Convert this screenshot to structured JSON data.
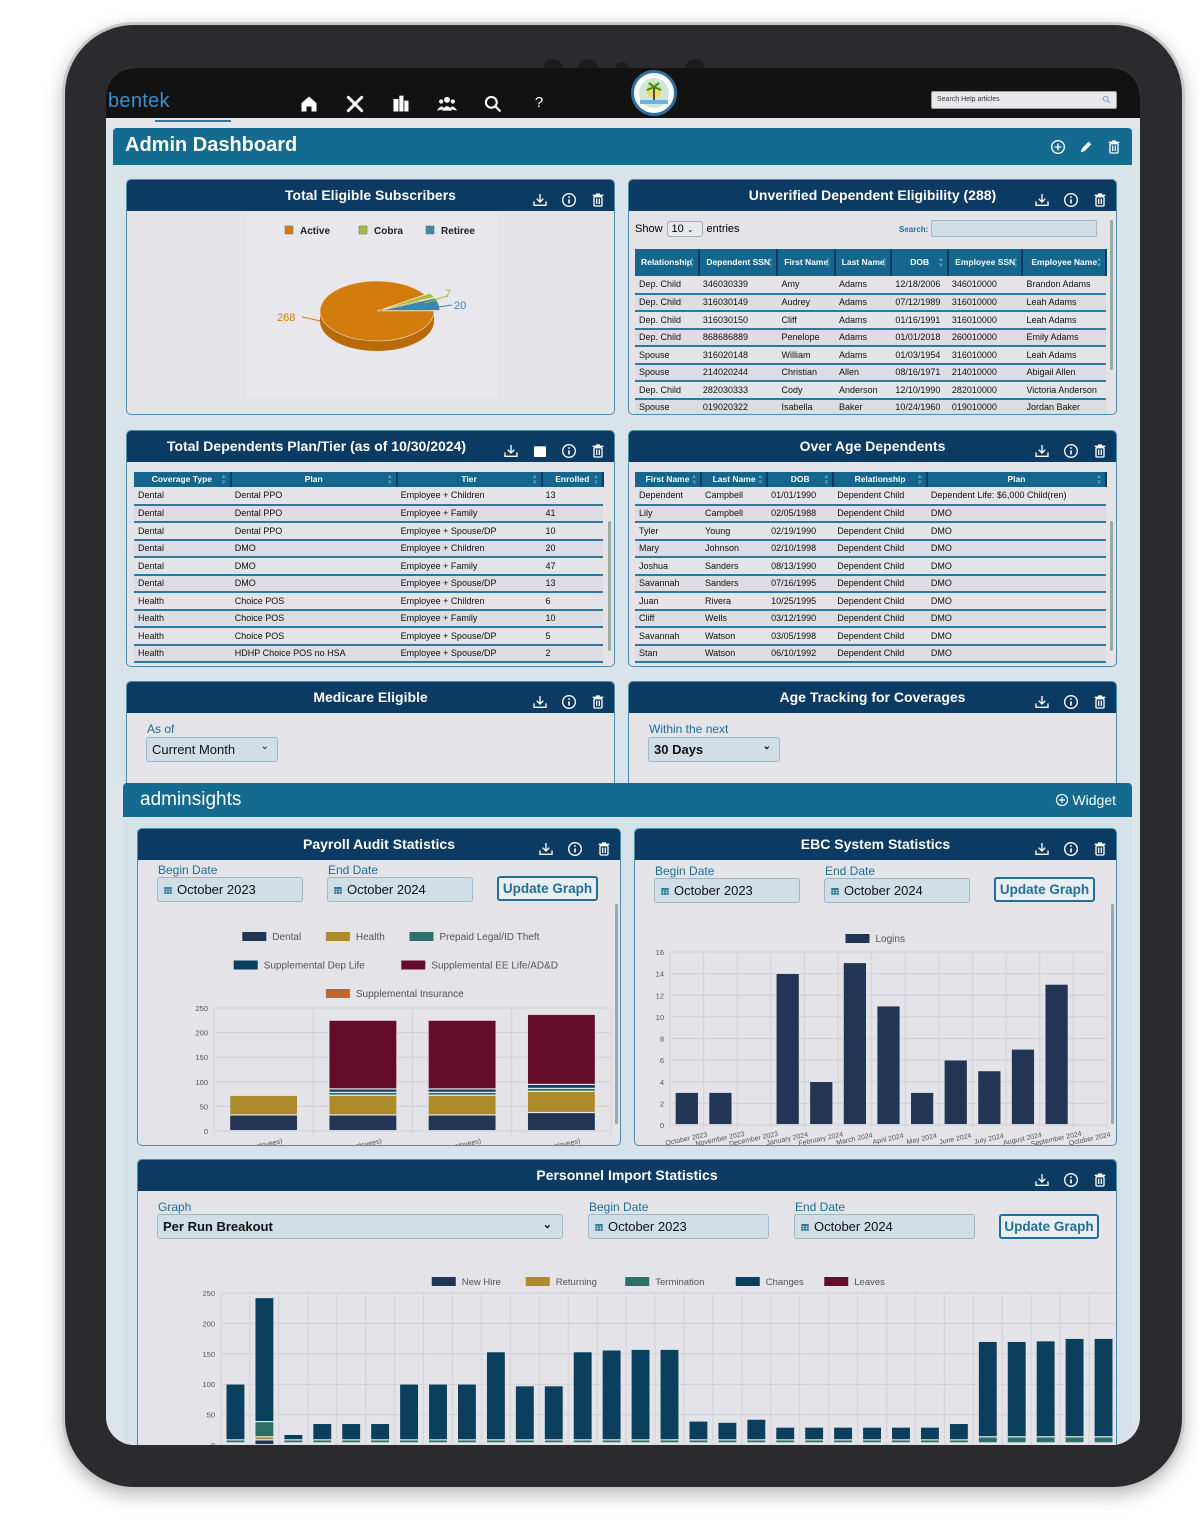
{
  "nav": {
    "logo": "bentek",
    "icons": [
      "home-icon",
      "tools-icon",
      "building-icon",
      "users-icon",
      "search-icon",
      "help-icon"
    ],
    "help_glyph": "?",
    "search_placeholder": "Search Help articles"
  },
  "dashboard": {
    "title": "Admin Dashboard"
  },
  "subscribers": {
    "title": "Total Eligible Subscribers",
    "chart_data": {
      "type": "pie",
      "categories": [
        "Active",
        "Cobra",
        "Retiree"
      ],
      "values": [
        268,
        7,
        20
      ],
      "colors": [
        "#d17c0c",
        "#a9b83f",
        "#3d87aa"
      ],
      "legend": "top"
    }
  },
  "unverified": {
    "title": "Unverified Dependent Eligibility (288)",
    "show": "Show",
    "entries_value": "10",
    "entries": "entries",
    "search_label": "Search:",
    "columns": [
      "Relationship",
      "Dependent SSN",
      "First Name",
      "Last Name",
      "DOB",
      "Employee SSN",
      "Employee Name"
    ],
    "rows": [
      [
        "Dep. Child",
        "346030339",
        "Amy",
        "Adams",
        "12/18/2006",
        "346010000",
        "Brandon Adams"
      ],
      [
        "Dep. Child",
        "316030149",
        "Audrey",
        "Adams",
        "07/12/1989",
        "316010000",
        "Leah Adams"
      ],
      [
        "Dep. Child",
        "316030150",
        "Cliff",
        "Adams",
        "01/16/1991",
        "316010000",
        "Leah Adams"
      ],
      [
        "Dep. Child",
        "868686889",
        "Penelope",
        "Adams",
        "01/01/2018",
        "260010000",
        "Emily Adams"
      ],
      [
        "Spouse",
        "316020148",
        "William",
        "Adams",
        "01/03/1954",
        "316010000",
        "Leah Adams"
      ],
      [
        "Spouse",
        "214020244",
        "Christian",
        "Allen",
        "08/16/1971",
        "214010000",
        "Abigail Allen"
      ],
      [
        "Dep. Child",
        "282030333",
        "Cody",
        "Anderson",
        "12/10/1990",
        "282010000",
        "Victoria Anderson"
      ],
      [
        "Spouse",
        "019020322",
        "Isabella",
        "Baker",
        "10/24/1960",
        "019010000",
        "Jordan Baker"
      ]
    ]
  },
  "plantier": {
    "title": "Total Dependents Plan/Tier (as of 10/30/2024)",
    "columns": [
      "Coverage Type",
      "Plan",
      "Tier",
      "Enrolled"
    ],
    "rows": [
      [
        "Dental",
        "Dental PPO",
        "Employee + Children",
        "13"
      ],
      [
        "Dental",
        "Dental PPO",
        "Employee + Family",
        "41"
      ],
      [
        "Dental",
        "Dental PPO",
        "Employee + Spouse/DP",
        "10"
      ],
      [
        "Dental",
        "DMO",
        "Employee + Children",
        "20"
      ],
      [
        "Dental",
        "DMO",
        "Employee + Family",
        "47"
      ],
      [
        "Dental",
        "DMO",
        "Employee + Spouse/DP",
        "13"
      ],
      [
        "Health",
        "Choice POS",
        "Employee + Children",
        "6"
      ],
      [
        "Health",
        "Choice POS",
        "Employee + Family",
        "10"
      ],
      [
        "Health",
        "Choice POS",
        "Employee + Spouse/DP",
        "5"
      ],
      [
        "Health",
        "HDHP Choice POS no HSA",
        "Employee + Spouse/DP",
        "2"
      ]
    ]
  },
  "overage": {
    "title": "Over Age Dependents",
    "columns": [
      "First Name",
      "Last Name",
      "DOB",
      "Relationship",
      "Plan"
    ],
    "rows": [
      [
        "Dependent",
        "Campbell",
        "01/01/1990",
        "Dependent Child",
        "Dependent Life: $6,000 Child(ren)"
      ],
      [
        "Lily",
        "Campbell",
        "02/05/1988",
        "Dependent Child",
        "DMO"
      ],
      [
        "Tyler",
        "Young",
        "02/19/1990",
        "Dependent Child",
        "DMO"
      ],
      [
        "Mary",
        "Johnson",
        "02/10/1998",
        "Dependent Child",
        "DMO"
      ],
      [
        "Joshua",
        "Sanders",
        "08/13/1990",
        "Dependent Child",
        "DMO"
      ],
      [
        "Savannah",
        "Sanders",
        "07/16/1995",
        "Dependent Child",
        "DMO"
      ],
      [
        "Juan",
        "Rivera",
        "10/25/1995",
        "Dependent Child",
        "DMO"
      ],
      [
        "Cliff",
        "Wells",
        "03/12/1990",
        "Dependent Child",
        "DMO"
      ],
      [
        "Savannah",
        "Watson",
        "03/05/1998",
        "Dependent Child",
        "DMO"
      ],
      [
        "Stan",
        "Watson",
        "06/10/1992",
        "Dependent Child",
        "DMO"
      ]
    ]
  },
  "medicare": {
    "title": "Medicare Eligible",
    "label": "As of",
    "value": "Current Month"
  },
  "agetracking": {
    "title": "Age Tracking for Coverages",
    "label": "Within the next",
    "value": "30 Days"
  },
  "insights": {
    "logo": "adminsights",
    "widget_button": "Widget"
  },
  "payroll": {
    "title": "Payroll Audit Statistics",
    "begin_label": "Begin Date",
    "begin_value": "October 2023",
    "end_label": "End Date",
    "end_value": "October 2024",
    "update": "Update Graph",
    "chart_data": {
      "type": "bar",
      "stacked": true,
      "categories": [
        "(Employees)",
        "(Employees)",
        "(Employees)",
        "(Employees)"
      ],
      "ylim": [
        0,
        250
      ],
      "yticks": [
        0,
        50,
        100,
        150,
        200,
        250
      ],
      "grid": true,
      "legend": "top",
      "series": [
        {
          "name": "Dental",
          "color": "#233554",
          "values": [
            32,
            32,
            32,
            37
          ]
        },
        {
          "name": "Health",
          "color": "#ad8a2a",
          "values": [
            40,
            40,
            40,
            43
          ]
        },
        {
          "name": "Prepaid Legal/ID Theft",
          "color": "#2f6f6a",
          "values": [
            0,
            6,
            6,
            6
          ]
        },
        {
          "name": "Supplemental Dep Life",
          "color": "#0b3f5e",
          "values": [
            0,
            7,
            7,
            8
          ]
        },
        {
          "name": "Supplemental EE Life/AD&D",
          "color": "#640c2a",
          "values": [
            0,
            140,
            140,
            143
          ]
        },
        {
          "name": "Supplemental Insurance",
          "color": "#c0652a",
          "values": [
            0,
            1,
            1,
            1
          ]
        }
      ]
    }
  },
  "ebc": {
    "title": "EBC System Statistics",
    "begin_label": "Begin Date",
    "begin_value": "October 2023",
    "end_label": "End Date",
    "end_value": "October 2024",
    "update": "Update Graph",
    "chart_data": {
      "type": "bar",
      "categories": [
        "October 2023",
        "November 2023",
        "December 2023",
        "January 2024",
        "February 2024",
        "March 2024",
        "April 2024",
        "May 2024",
        "June 2024",
        "July 2024",
        "August 2024",
        "September 2024",
        "October 2024"
      ],
      "ylim": [
        0,
        16
      ],
      "yticks": [
        0,
        2,
        4,
        6,
        8,
        10,
        12,
        14,
        16
      ],
      "grid": true,
      "legend": "top",
      "series": [
        {
          "name": "Logins",
          "color": "#233554",
          "values": [
            3,
            3,
            0,
            14,
            4,
            15,
            11,
            3,
            6,
            5,
            7,
            13,
            0
          ]
        }
      ]
    }
  },
  "personnel": {
    "title": "Personnel Import Statistics",
    "graph_label": "Graph",
    "graph_value": "Per Run Breakout",
    "begin_label": "Begin Date",
    "begin_value": "October 2023",
    "end_label": "End Date",
    "end_value": "October 2024",
    "update": "Update Graph",
    "chart_data": {
      "type": "bar",
      "stacked": true,
      "ylim": [
        0,
        250
      ],
      "yticks": [
        0,
        50,
        100,
        150,
        200,
        250
      ],
      "grid": true,
      "legend": "top",
      "series": [
        {
          "name": "New Hire",
          "color": "#233554",
          "values": [
            1,
            8,
            1,
            1,
            1,
            1,
            1,
            1,
            1,
            1,
            1,
            1,
            1,
            1,
            1,
            1,
            1,
            1,
            1,
            1,
            1,
            1,
            1,
            1,
            1,
            1,
            1,
            1,
            1,
            1,
            1
          ]
        },
        {
          "name": "Returning",
          "color": "#ad8a2a",
          "values": [
            2,
            5,
            2,
            2,
            2,
            2,
            2,
            2,
            2,
            2,
            2,
            2,
            2,
            2,
            2,
            2,
            2,
            2,
            2,
            2,
            2,
            2,
            2,
            2,
            2,
            2,
            2,
            2,
            2,
            2,
            2
          ]
        },
        {
          "name": "Termination",
          "color": "#2f6f6a",
          "values": [
            5,
            25,
            5,
            5,
            5,
            5,
            5,
            5,
            5,
            5,
            5,
            5,
            5,
            5,
            5,
            5,
            5,
            5,
            5,
            5,
            5,
            5,
            5,
            5,
            5,
            5,
            10,
            10,
            10,
            10,
            10
          ]
        },
        {
          "name": "Changes",
          "color": "#0b3f5e",
          "values": [
            92,
            204,
            9,
            27,
            27,
            27,
            92,
            92,
            92,
            145,
            89,
            89,
            145,
            148,
            149,
            149,
            31,
            29,
            34,
            21,
            21,
            21,
            21,
            21,
            21,
            27,
            157,
            157,
            158,
            162,
            162
          ]
        },
        {
          "name": "Leaves",
          "color": "#640c2a",
          "values": [
            0,
            0,
            0,
            0,
            0,
            0,
            0,
            0,
            0,
            0,
            0,
            0,
            0,
            0,
            0,
            0,
            0,
            0,
            0,
            0,
            0,
            0,
            0,
            0,
            0,
            0,
            0,
            0,
            0,
            0,
            0
          ]
        }
      ]
    }
  }
}
